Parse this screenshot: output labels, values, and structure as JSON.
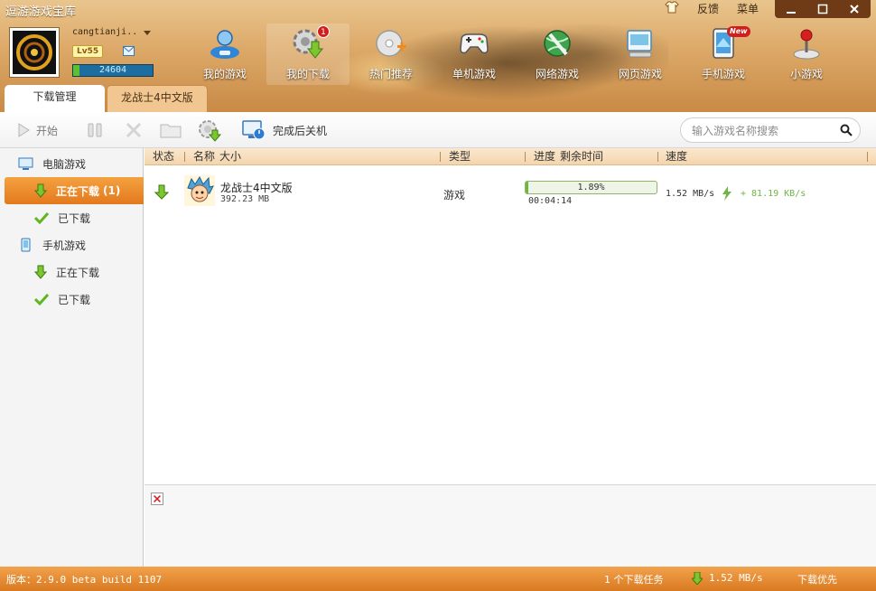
{
  "app": {
    "title": "逗游游戏宝库",
    "feedback_label": "反馈",
    "menu_label": "菜单"
  },
  "user": {
    "name": "cangtianji..",
    "level": "Lv55",
    "exp": "24604",
    "exp_fraction": 0.08
  },
  "top_nav": [
    {
      "label": "我的游戏",
      "icon": "user-games-icon"
    },
    {
      "label": "我的下载",
      "icon": "download-gear-icon",
      "badge": "1"
    },
    {
      "label": "热门推荐",
      "icon": "disc-plus-icon"
    },
    {
      "label": "单机游戏",
      "icon": "gamepad-icon"
    },
    {
      "label": "网络游戏",
      "icon": "globe-icon"
    },
    {
      "label": "网页游戏",
      "icon": "web-mouse-icon"
    },
    {
      "label": "手机游戏",
      "icon": "tablet-icon",
      "badge": "New"
    },
    {
      "label": "小游戏",
      "icon": "joystick-icon"
    }
  ],
  "tabs": [
    {
      "label": "下载管理"
    },
    {
      "label": "龙战士4中文版"
    }
  ],
  "toolbar": {
    "start_label": "开始",
    "shutdown_label": "完成后关机"
  },
  "search": {
    "placeholder": "输入游戏名称搜索"
  },
  "sidebar": {
    "pc_label": "电脑游戏",
    "pc_downloading_label": "正在下载",
    "pc_downloading_count": "(1)",
    "pc_downloaded_label": "已下载",
    "mobile_label": "手机游戏",
    "mobile_downloading_label": "正在下载",
    "mobile_downloaded_label": "已下载"
  },
  "columns": {
    "status": "状态",
    "name": "名称",
    "size": "大小",
    "type": "类型",
    "progress": "进度",
    "remaining": "剩余时间",
    "speed": "速度"
  },
  "downloads": [
    {
      "name": "龙战士4中文版",
      "size": "392.23 MB",
      "type": "游戏",
      "progress_text": "1.89%",
      "progress_fraction": 0.0189,
      "remaining": "00:04:14",
      "speed": "1.52 MB/s",
      "boost": "+ 81.19 KB/s"
    }
  ],
  "status_bar": {
    "version": "版本：2.9.0 beta build 1107",
    "task_count": "1 个下载任务",
    "speed": "1.52 MB/s",
    "priority": "下载优先"
  },
  "colors": {
    "accent_orange": "#e3791d",
    "progress_green": "#6cb83a",
    "boost_green": "#71b548"
  }
}
